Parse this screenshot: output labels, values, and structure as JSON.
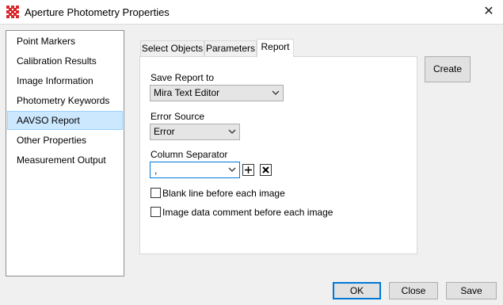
{
  "window": {
    "title": "Aperture Photometry Properties",
    "close_glyph": "✕"
  },
  "sidebar": {
    "items": [
      {
        "label": "Point Markers",
        "selected": false
      },
      {
        "label": "Calibration Results",
        "selected": false
      },
      {
        "label": "Image Information",
        "selected": false
      },
      {
        "label": "Photometry Keywords",
        "selected": false
      },
      {
        "label": "AAVSO Report",
        "selected": true
      },
      {
        "label": "Other Properties",
        "selected": false
      },
      {
        "label": "Measurement Output",
        "selected": false
      }
    ]
  },
  "tabs": [
    {
      "label": "Select Objects",
      "active": false
    },
    {
      "label": "Parameters",
      "active": false
    },
    {
      "label": "Report",
      "active": true
    }
  ],
  "report": {
    "save_report_label": "Save Report to",
    "save_report_value": "Mira Text Editor",
    "error_source_label": "Error Source",
    "error_source_value": "Error",
    "column_separator_label": "Column Separator",
    "column_separator_value": ",",
    "blank_line_label": "Blank line before each image",
    "blank_line_checked": false,
    "image_comment_label": "Image data comment before each image",
    "image_comment_checked": false
  },
  "buttons": {
    "create": "Create",
    "ok": "OK",
    "close": "Close",
    "save": "Save"
  },
  "colors": {
    "accent": "#0078d7",
    "selection": "#cce8ff",
    "app_icon": "#d9262b"
  },
  "icons": {
    "app": "mira-grid-icon",
    "close": "close-icon",
    "add": "plus-icon",
    "delete": "x-box-icon",
    "dropdown": "chevron-down-icon"
  }
}
